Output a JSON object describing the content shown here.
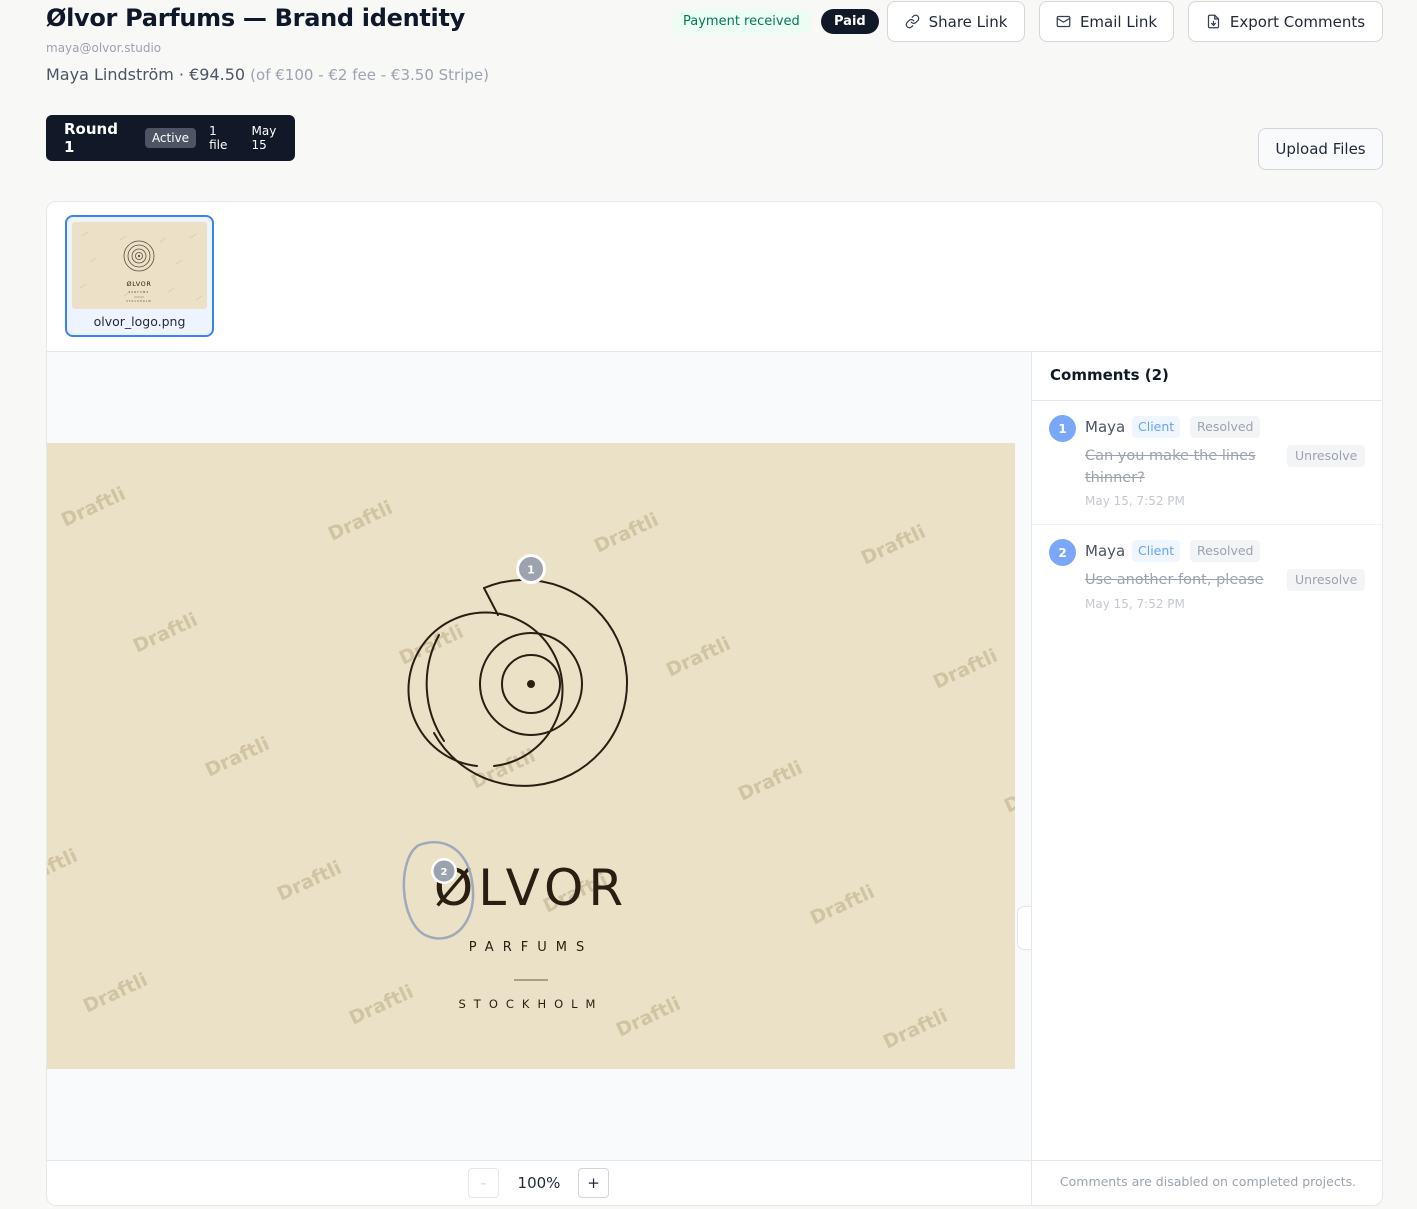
{
  "project": {
    "title": "Ølvor Parfums — Brand identity",
    "client_email": "maya@olvor.studio",
    "client_name_amount": "Maya Lindström · €94.50",
    "amount_breakdown": "(of €100 - €2 fee - €3.50 Stripe)"
  },
  "badges": {
    "payment": "Payment received",
    "status": "Paid"
  },
  "header_actions": {
    "share": "Share Link",
    "email": "Email Link",
    "export": "Export Comments"
  },
  "round": {
    "name": "Round 1",
    "state": "Active",
    "files": "1 file",
    "date": "May 15"
  },
  "upload_label": "Upload Files",
  "files": [
    {
      "name": "olvor_logo.png"
    }
  ],
  "artwork": {
    "brand": "ØLVOR",
    "subtitle": "PARFUMS",
    "city": "STOCKHOLM",
    "watermark": "Draftli",
    "pins": [
      "1",
      "2"
    ]
  },
  "comments": {
    "header": "Comments (2)",
    "items": [
      {
        "number": "1",
        "author": "Maya",
        "role": "Client",
        "status": "Resolved",
        "text": "Can you make the lines thinner?",
        "action": "Unresolve",
        "time": "May 15, 7:52 PM"
      },
      {
        "number": "2",
        "author": "Maya",
        "role": "Client",
        "status": "Resolved",
        "text": "Use another font, please",
        "action": "Unresolve",
        "time": "May 15, 7:52 PM"
      }
    ],
    "disabled_note": "Comments are disabled on completed projects."
  },
  "zoom": {
    "minus": "-",
    "level": "100%",
    "plus": "+"
  },
  "colors": {
    "accent": "#3b82f6",
    "dark": "#111827",
    "artwork_bg": "#ebe1c6",
    "pin_blue": "#7aa7f7",
    "success": "#047857"
  },
  "icons": {
    "share": "link-icon",
    "email": "mail-icon",
    "export": "file-export-icon",
    "collapse": "chevron-right-icon"
  }
}
